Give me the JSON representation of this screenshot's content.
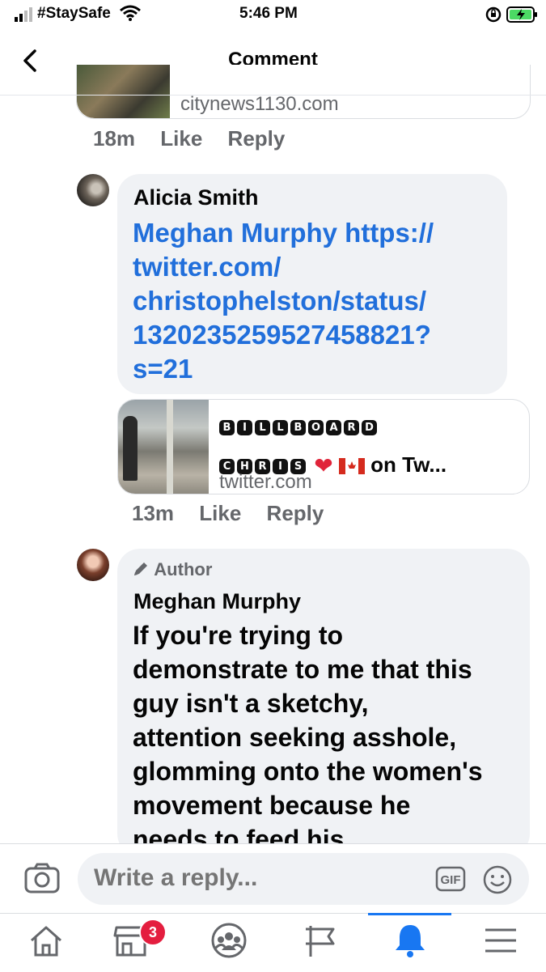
{
  "status_bar": {
    "carrier": "#StaySafe",
    "time": "5:46 PM"
  },
  "header": {
    "title": "Comment"
  },
  "comments": [
    {
      "link_card": {
        "domain": "citynews1130.com"
      },
      "time": "18m",
      "like": "Like",
      "reply": "Reply"
    },
    {
      "author": "Alicia Smith",
      "text_lines": [
        "Meghan Murphy https://",
        "twitter.com/",
        "christophelston/status/",
        "1320235259527458821?",
        "s=21"
      ],
      "link_card": {
        "title_tiles_row1": [
          "B",
          "I",
          "L",
          "L",
          "B",
          "O",
          "A",
          "R",
          "D"
        ],
        "title_tiles_row2": [
          "C",
          "H",
          "R",
          "I",
          "S"
        ],
        "title_suffix": "on Tw...",
        "domain": "twitter.com"
      },
      "time": "13m",
      "like": "Like",
      "reply": "Reply"
    },
    {
      "badge": "Author",
      "author": "Meghan Murphy",
      "text_lines": [
        "If you're trying to",
        "demonstrate to me that this",
        "guy isn't a sketchy,",
        "attention seeking asshole,",
        "glomming onto the women's",
        "movement because he",
        "needs to feed his"
      ]
    }
  ],
  "composer": {
    "placeholder": "Write a reply...",
    "gif_label": "GIF"
  },
  "tabbar": {
    "marketplace_badge": "3",
    "active": "notifications"
  },
  "colors": {
    "link": "#216fdb",
    "bubble": "#f0f2f5",
    "meta": "#65676b",
    "accent": "#1877f2",
    "badge": "#e41e3f"
  }
}
